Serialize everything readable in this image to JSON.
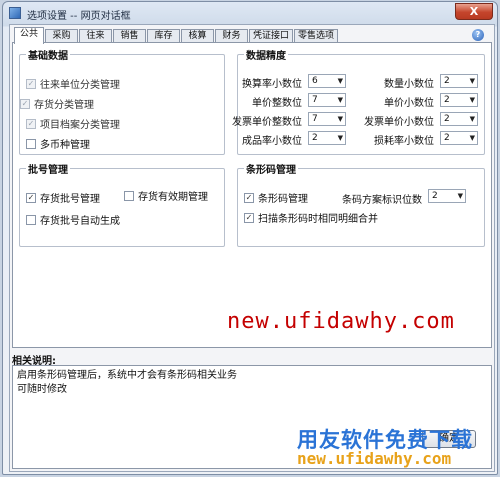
{
  "window": {
    "title": "选项设置 -- 网页对话框",
    "close_glyph": "X"
  },
  "tabs": [
    "公共",
    "采购",
    "往来",
    "销售",
    "库存",
    "核算",
    "财务",
    "凭证接口",
    "零售选项"
  ],
  "active_tab": "公共",
  "basic_data": {
    "legend": "基础数据",
    "items": [
      {
        "label": "往来单位分类管理",
        "checked": true,
        "disabled": true
      },
      {
        "label": "存货分类管理",
        "checked": true,
        "disabled": true
      },
      {
        "label": "项目档案分类管理",
        "checked": true,
        "disabled": true
      },
      {
        "label": "多币种管理",
        "checked": false,
        "disabled": false
      }
    ]
  },
  "precision": {
    "legend": "数据精度",
    "left": [
      {
        "label": "换算率小数位",
        "value": "6"
      },
      {
        "label": "单价整数位",
        "value": "7"
      },
      {
        "label": "发票单价整数位",
        "value": "7"
      },
      {
        "label": "成品率小数位",
        "value": "2"
      }
    ],
    "right": [
      {
        "label": "数量小数位",
        "value": "2"
      },
      {
        "label": "单价小数位",
        "value": "2"
      },
      {
        "label": "发票单价小数位",
        "value": "2"
      },
      {
        "label": "损耗率小数位",
        "value": "2"
      }
    ]
  },
  "batch": {
    "legend": "批号管理",
    "items": [
      {
        "label": "存货批号管理",
        "checked": true
      },
      {
        "label": "存货有效期管理",
        "checked": false
      },
      {
        "label": "存货批号自动生成",
        "checked": false
      }
    ]
  },
  "barcode": {
    "legend": "条形码管理",
    "items": [
      {
        "label": "条形码管理",
        "checked": true
      },
      {
        "label": "扫描条形码时相同明细合并",
        "checked": true
      }
    ],
    "digits_label": "条码方案标识位数",
    "digits_value": "2"
  },
  "description": {
    "title": "相关说明:",
    "lines": [
      "启用条形码管理后，系统中才会有条形码相关业务",
      "可随时修改"
    ]
  },
  "ok_button": "确定",
  "help_glyph": "?",
  "check_glyph": "✓",
  "arrow_glyph": "▼",
  "watermarks": {
    "url_mid": "new.ufidawhy.com",
    "cn": "用友软件免费下载",
    "url_bottom": "new.ufidawhy.com"
  },
  "colors": {
    "watermark_red": "#c40000",
    "watermark_blue": "#2a73d6",
    "watermark_orange": "#e8a21a"
  }
}
